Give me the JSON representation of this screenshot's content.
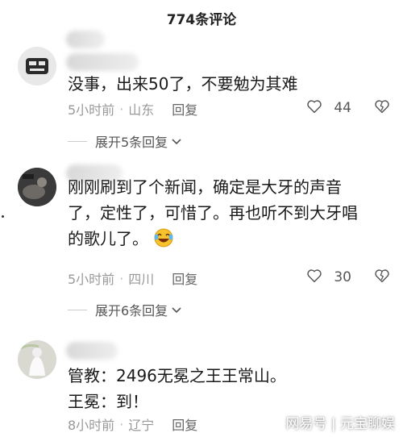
{
  "header": {
    "title": "774条评论"
  },
  "comments": [
    {
      "text_lines": [
        "没事，出来50了，不要勉为其难"
      ],
      "time": "5小时前",
      "location": "山东",
      "reply_label": "回复",
      "likes": "44",
      "expand_label": "展开5条回复"
    },
    {
      "text_lines": [
        "刚刚刷到了个新闻，确定是大牙的声音",
        "了，定性了，可惜了。再也听不到大牙唱",
        "的歌儿了。"
      ],
      "time": "5小时前",
      "location": "四川",
      "reply_label": "回复",
      "likes": "30",
      "expand_label": "展开6条回复"
    },
    {
      "text_lines": [
        "管教：2496无冕之王王常山。",
        "王冕：到！"
      ],
      "time": "8小时前",
      "location": "辽宁",
      "reply_label": "回复"
    }
  ],
  "watermark": "网易号 | 元宝聊娱",
  "colors": {
    "meta_gray": "#999999",
    "text": "#1a1a1a"
  }
}
